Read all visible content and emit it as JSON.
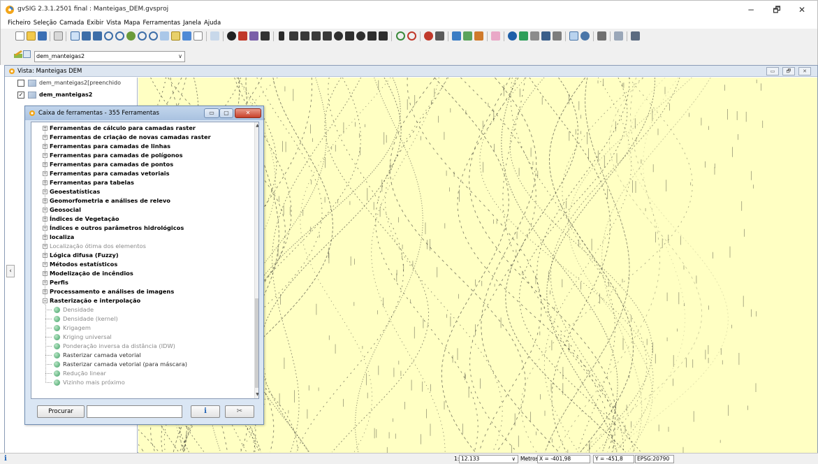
{
  "app": {
    "title": "gvSIG 2.3.1.2501 final : Manteigas_DEM.gvsproj",
    "window_buttons": {
      "minimize": "−",
      "maximize": "🗗",
      "close": "✕"
    }
  },
  "menu": [
    "Ficheiro",
    "Seleção",
    "Camada",
    "Exibir",
    "Vista",
    "Mapa",
    "Ferramentas",
    "Janela",
    "Ajuda"
  ],
  "layer_selector": {
    "value": "dem_manteigas2",
    "arrow": "∨"
  },
  "view": {
    "title": "Vista: Manteigas DEM",
    "buttons": {
      "minimize": "▭",
      "restore": "🗗",
      "close": "✕"
    },
    "background_color": "#ffffc3",
    "contour_color": "#1a1a1a"
  },
  "toc": {
    "layers": [
      {
        "name": "dem_manteigas2[preenchido",
        "checked": false
      },
      {
        "name": "dem_manteigas2",
        "checked": true
      }
    ],
    "scroll_left": "‹"
  },
  "toolbox": {
    "title": "Caixa de ferramentas - 355 Ferramentas",
    "buttons": {
      "minimize": "▭",
      "maximize": "▢",
      "close": "✕"
    },
    "groups": [
      {
        "label": "Ferramentas de cálculo para camadas raster",
        "style": "bold"
      },
      {
        "label": "Ferramentas de criação de novas camadas raster",
        "style": "bold"
      },
      {
        "label": "Ferramentas para camadas de linhas",
        "style": "bold"
      },
      {
        "label": "Ferramentas para camadas de polígonos",
        "style": "bold"
      },
      {
        "label": "Ferramentas para camadas de pontos",
        "style": "bold"
      },
      {
        "label": "Ferramentas para camadas vetoriais",
        "style": "bold"
      },
      {
        "label": "Ferramentas para tabelas",
        "style": "bold"
      },
      {
        "label": "Geoestatísticas",
        "style": "bold"
      },
      {
        "label": "Geomorfometria e análises de relevo",
        "style": "bold"
      },
      {
        "label": "Geosocial",
        "style": "bold"
      },
      {
        "label": "Índices de Vegetação",
        "style": "bold"
      },
      {
        "label": "Índices e outros parâmetros hidrológicos",
        "style": "bold"
      },
      {
        "label": "localiza",
        "style": "bold"
      },
      {
        "label": "Localização ótima dos elementos",
        "style": "gray"
      },
      {
        "label": "Lógica difusa (Fuzzy)",
        "style": "bold"
      },
      {
        "label": "Métodos estatísticos",
        "style": "bold"
      },
      {
        "label": "Modelização de incêndios",
        "style": "bold"
      },
      {
        "label": "Perfis",
        "style": "bold"
      },
      {
        "label": "Processamento e análises de imagens",
        "style": "bold"
      },
      {
        "label": "Rasterização e interpolação",
        "style": "bold",
        "expanded": true
      }
    ],
    "leaves": [
      {
        "label": "Densidade",
        "style": "gray"
      },
      {
        "label": "Densidade (kernel)",
        "style": "gray"
      },
      {
        "label": "Krigagem",
        "style": "gray"
      },
      {
        "label": "Kriging universal",
        "style": "gray"
      },
      {
        "label": "Ponderação inversa da distância (IDW)",
        "style": "gray"
      },
      {
        "label": "Rasterizar camada vetorial",
        "style": "dark"
      },
      {
        "label": "Rasterizar camada vetorial (para máscara)",
        "style": "dark"
      },
      {
        "label": "Redução linear",
        "style": "gray"
      },
      {
        "label": "Vizinho mais próximo",
        "style": "gray"
      }
    ],
    "expander_collapsed": "+",
    "expander_expanded": "−",
    "search_button": "Procurar",
    "search_value": "",
    "info_button": "i",
    "tools_button": "✂",
    "scroll_up": "▲",
    "scroll_down": "▼"
  },
  "status": {
    "scale_prefix": "1:",
    "scale": "12.133",
    "scale_arrow": "∨",
    "units": "Metros",
    "x": "X = -401,98",
    "y": "Y = -451,8",
    "epsg": "EPSG:20790",
    "info_icon": "i"
  }
}
